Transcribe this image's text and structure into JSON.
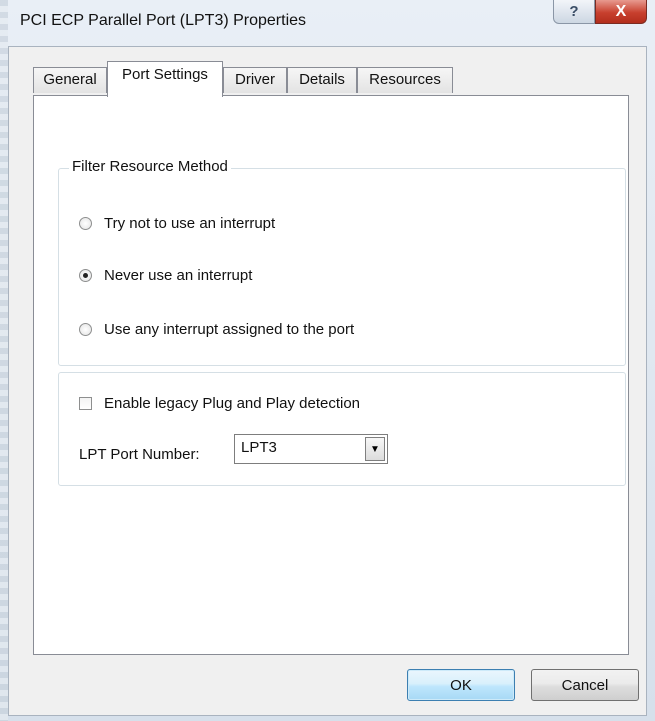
{
  "window": {
    "title": "PCI ECP Parallel Port (LPT3) Properties",
    "help_glyph": "?",
    "close_glyph": "X"
  },
  "tabs": [
    {
      "label": "General",
      "active": false
    },
    {
      "label": "Port Settings",
      "active": true
    },
    {
      "label": "Driver",
      "active": false
    },
    {
      "label": "Details",
      "active": false
    },
    {
      "label": "Resources",
      "active": false
    }
  ],
  "filter_group": {
    "title": "Filter Resource Method",
    "options": [
      {
        "label": "Try not to use an interrupt",
        "selected": false
      },
      {
        "label": "Never use an interrupt",
        "selected": true
      },
      {
        "label": "Use any interrupt assigned to the port",
        "selected": false
      }
    ]
  },
  "legacy": {
    "checkbox_label": "Enable legacy Plug and Play detection",
    "checked": false,
    "port_label": "LPT Port Number:",
    "port_value": "LPT3",
    "dropdown_glyph": "▼"
  },
  "buttons": {
    "ok": "OK",
    "cancel": "Cancel"
  },
  "colors": {
    "close_button": "#c8402e",
    "ok_border": "#3c7fb1"
  }
}
